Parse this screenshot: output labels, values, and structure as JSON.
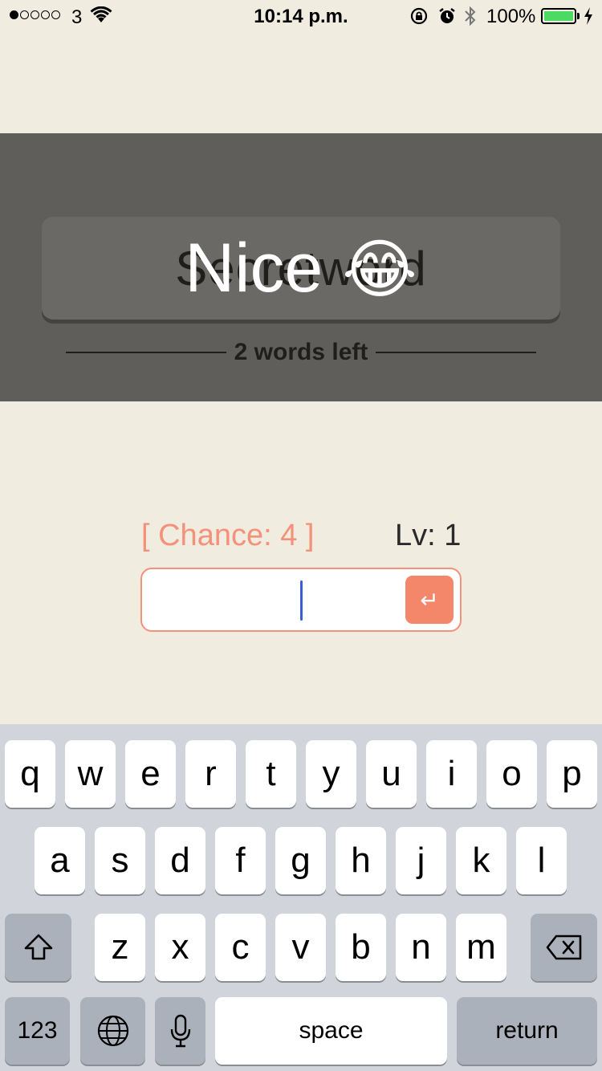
{
  "status_bar": {
    "carrier": "3",
    "time": "10:14 p.m.",
    "battery": "100%",
    "icons": [
      "signal-dots-icon",
      "wifi-icon",
      "rotation-lock-icon",
      "alarm-icon",
      "bluetooth-icon",
      "battery-icon",
      "charging-bolt-icon"
    ]
  },
  "game": {
    "secret_word": "Secretword",
    "overlay_message": "Nice",
    "overlay_emoji": "😂",
    "words_left": "2 words left",
    "chance": "[ Chance: 4 ]",
    "level": "Lv: 1",
    "answer_value": "",
    "submit_icon": "↵"
  },
  "keyboard": {
    "row1": [
      "q",
      "w",
      "e",
      "r",
      "t",
      "y",
      "u",
      "i",
      "o",
      "p"
    ],
    "row2": [
      "a",
      "s",
      "d",
      "f",
      "g",
      "h",
      "j",
      "k",
      "l"
    ],
    "row3": [
      "z",
      "x",
      "c",
      "v",
      "b",
      "n",
      "m"
    ],
    "numbers_label": "123",
    "space_label": "space",
    "return_label": "return",
    "icons": [
      "shift-icon",
      "backspace-icon",
      "globe-icon",
      "microphone-icon"
    ]
  }
}
